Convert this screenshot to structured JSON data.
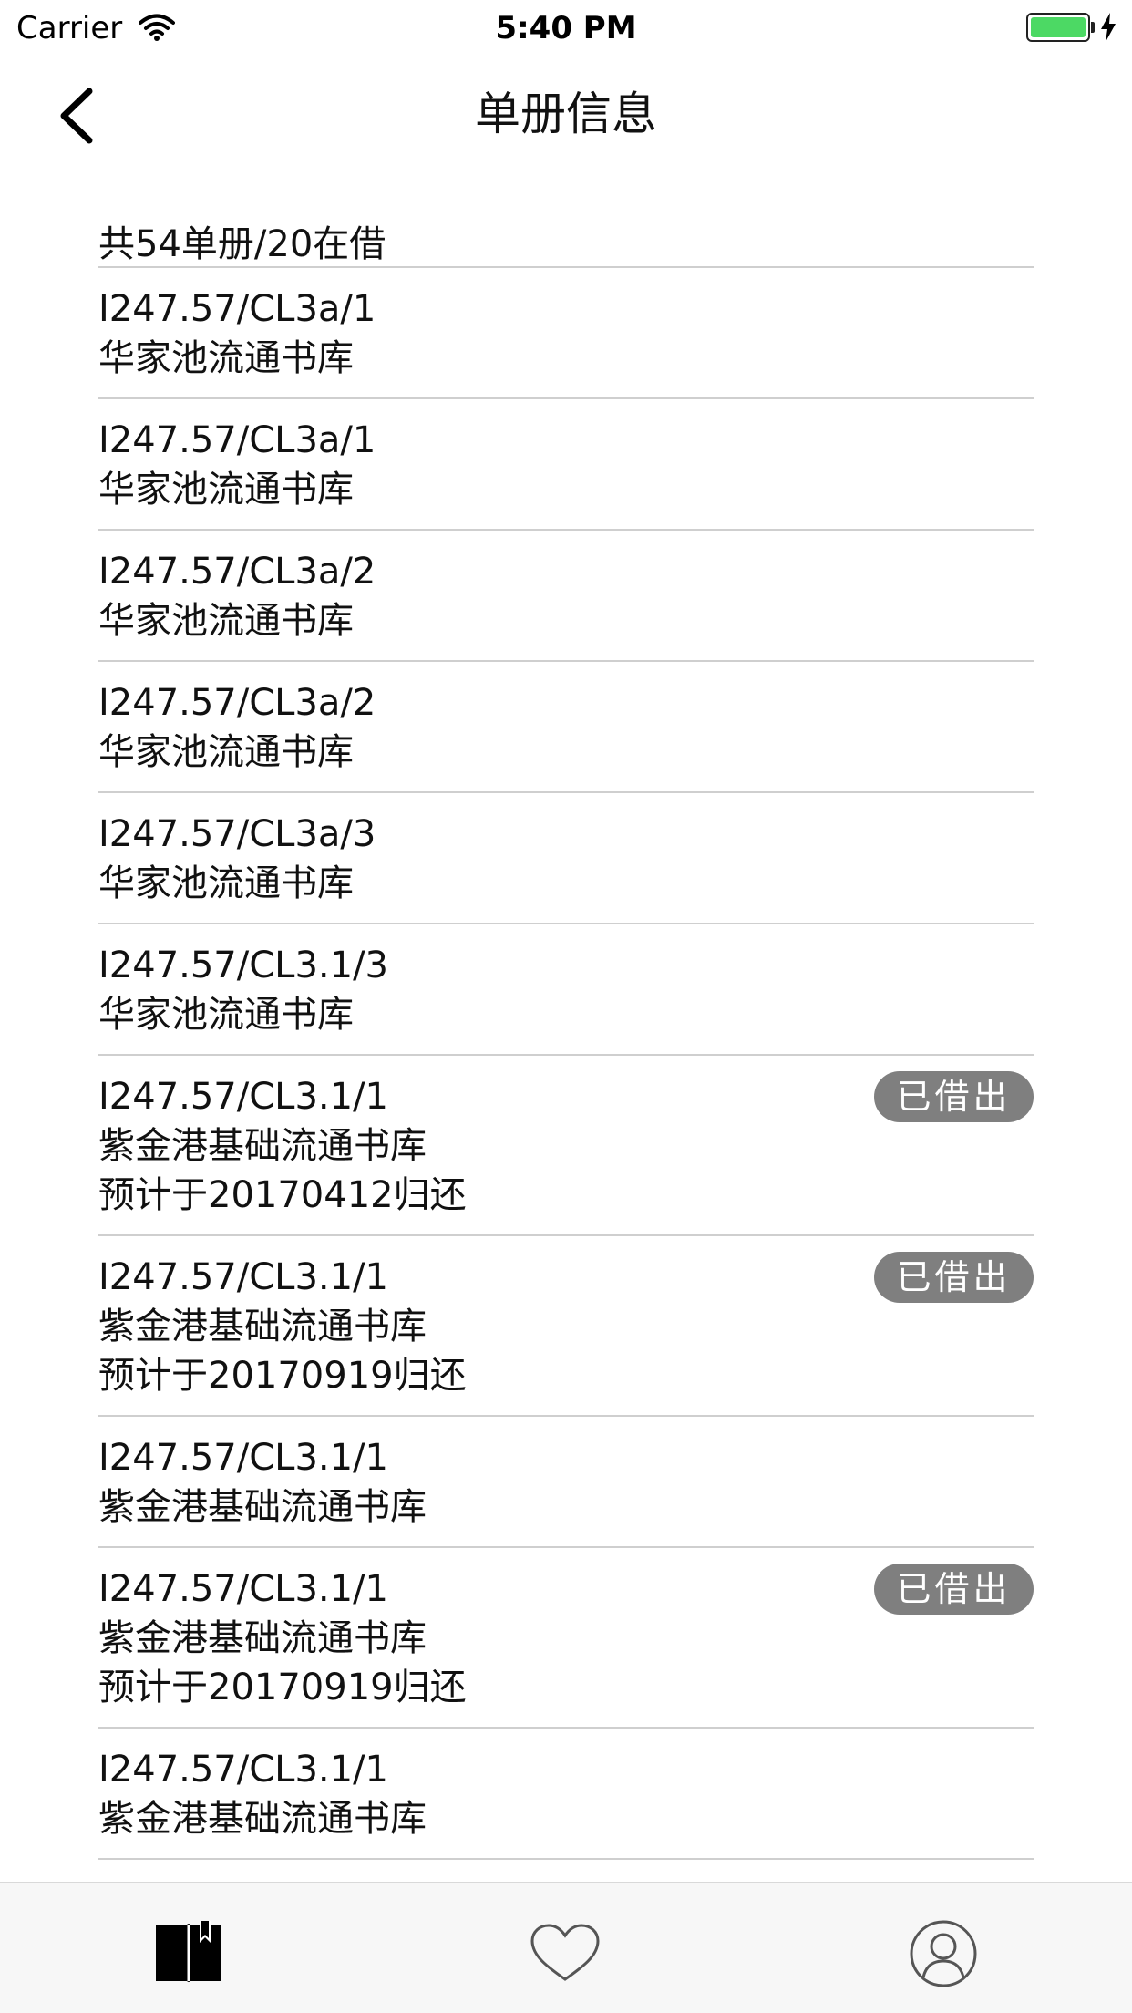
{
  "status_bar": {
    "carrier": "Carrier",
    "time": "5:40 PM",
    "battery_color": "#4cd964"
  },
  "nav": {
    "title": "单册信息",
    "back_icon": "chevron-left-icon"
  },
  "summary": "共54单册/20在借",
  "items": [
    {
      "call_number": "I247.57/CL3a/1",
      "location": "华家池流通书库",
      "due": "",
      "badge": ""
    },
    {
      "call_number": "I247.57/CL3a/1",
      "location": "华家池流通书库",
      "due": "",
      "badge": ""
    },
    {
      "call_number": "I247.57/CL3a/2",
      "location": "华家池流通书库",
      "due": "",
      "badge": ""
    },
    {
      "call_number": "I247.57/CL3a/2",
      "location": "华家池流通书库",
      "due": "",
      "badge": ""
    },
    {
      "call_number": "I247.57/CL3a/3",
      "location": "华家池流通书库",
      "due": "",
      "badge": ""
    },
    {
      "call_number": "I247.57/CL3.1/3",
      "location": "华家池流通书库",
      "due": "",
      "badge": ""
    },
    {
      "call_number": "I247.57/CL3.1/1",
      "location": "紫金港基础流通书库",
      "due": "预计于20170412归还",
      "badge": "已借出"
    },
    {
      "call_number": "I247.57/CL3.1/1",
      "location": "紫金港基础流通书库",
      "due": "预计于20170919归还",
      "badge": "已借出"
    },
    {
      "call_number": "I247.57/CL3.1/1",
      "location": "紫金港基础流通书库",
      "due": "",
      "badge": ""
    },
    {
      "call_number": "I247.57/CL3.1/1",
      "location": "紫金港基础流通书库",
      "due": "预计于20170919归还",
      "badge": "已借出"
    },
    {
      "call_number": "I247.57/CL3.1/1",
      "location": "紫金港基础流通书库",
      "due": "",
      "badge": ""
    }
  ],
  "badge_color": "#7f7f7f",
  "tab_bar": {
    "tabs": [
      {
        "icon": "book-icon",
        "selected": true
      },
      {
        "icon": "heart-icon",
        "selected": false
      },
      {
        "icon": "user-icon",
        "selected": false
      }
    ]
  }
}
